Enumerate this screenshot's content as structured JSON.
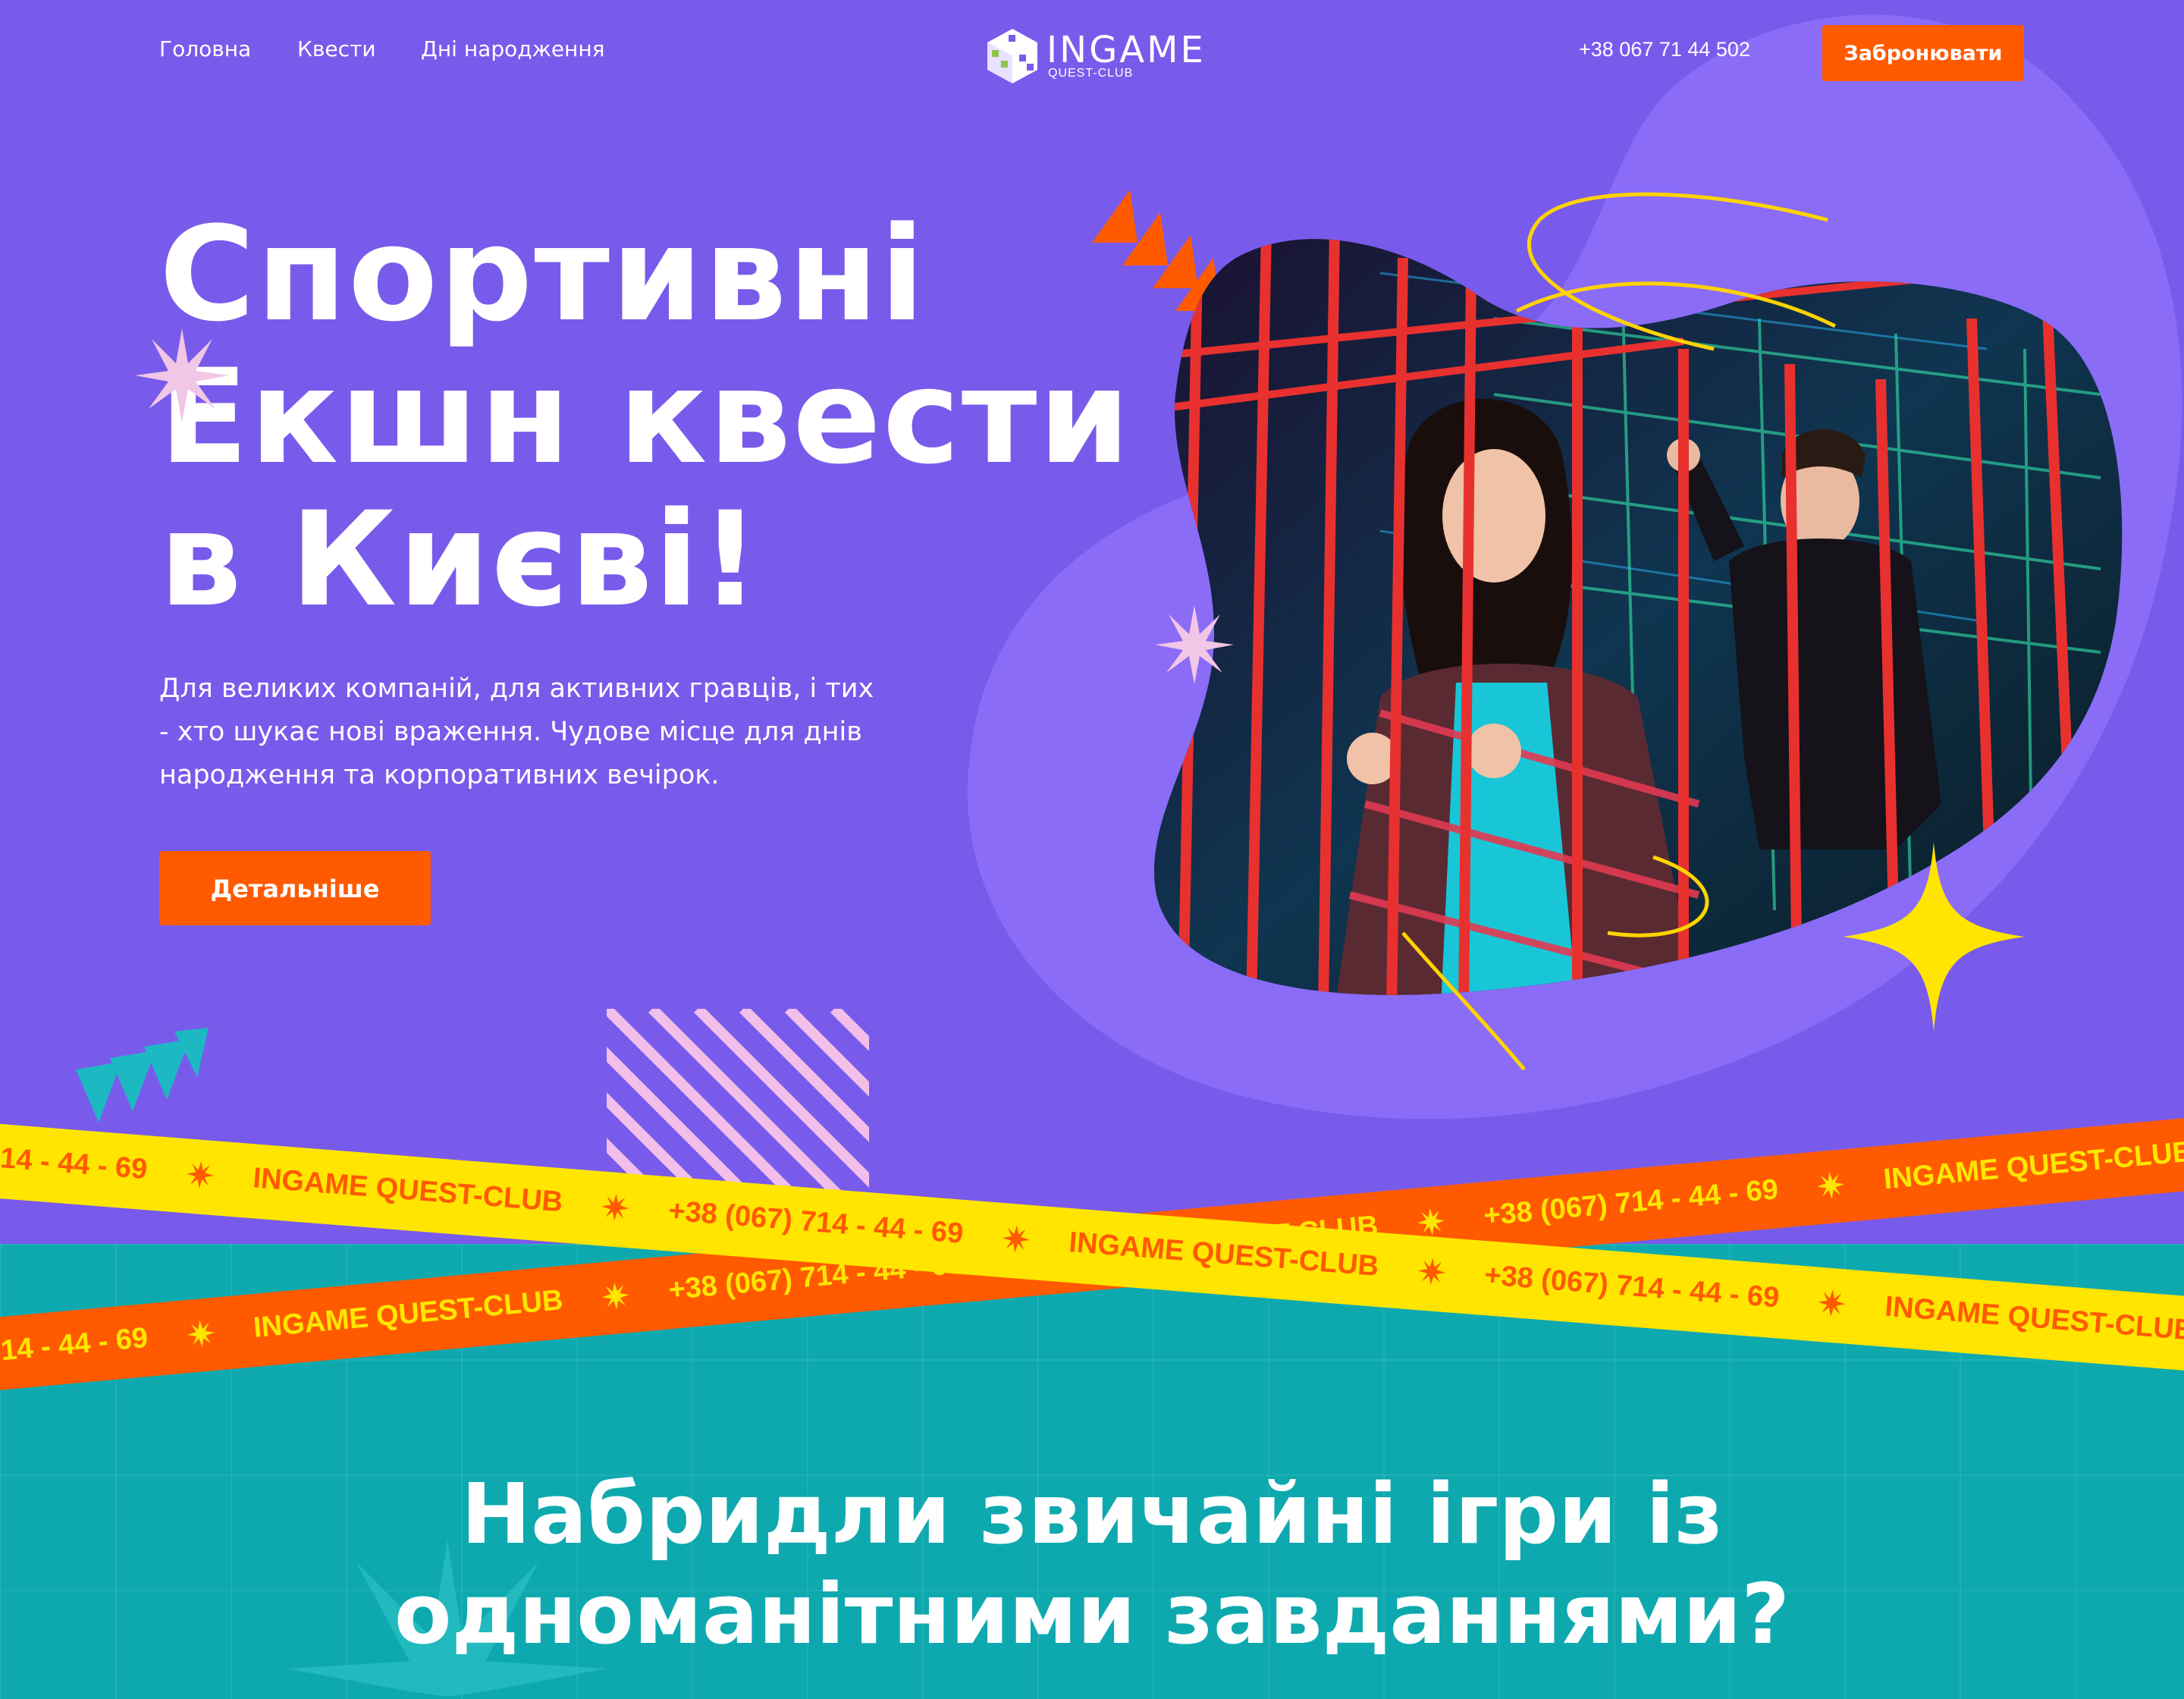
{
  "header": {
    "nav": [
      "Головна",
      "Квести",
      "Дні народження"
    ],
    "logo": {
      "word": "INGAME",
      "sub": "QUEST-CLUB"
    },
    "phone": "+38 067 71 44 502",
    "book_button": "Забронювати"
  },
  "hero": {
    "title_lines": [
      "Спортивні",
      "Екшн квести",
      "в Києві!"
    ],
    "description": "Для великих компаній, для активних гравців, і тих - хто шукає нові враження. Чудове місце для днів народження та корпоративних вечірок.",
    "details_button": "Детальніше",
    "photo_alt": "Двоє гравців за червоними ґратами у неоновому квест-лабіринті"
  },
  "ribbons": {
    "brand": "INGAME QUEST-CLUB",
    "phone": "+38 (067) 714 - 44 - 69"
  },
  "section2": {
    "title_lines": [
      "Набридли звичайні ігри із",
      "одноманітними завданнями?"
    ]
  },
  "colors": {
    "background": "#785BEB",
    "accent": "#FF5A00",
    "yellow": "#FFE500",
    "teal": "#0EA9AF"
  },
  "icons": [
    "logo-cube-icon",
    "sun-burst-icon",
    "sparkle-star-icon",
    "triangle-arrows-icon",
    "stripes-pattern"
  ]
}
